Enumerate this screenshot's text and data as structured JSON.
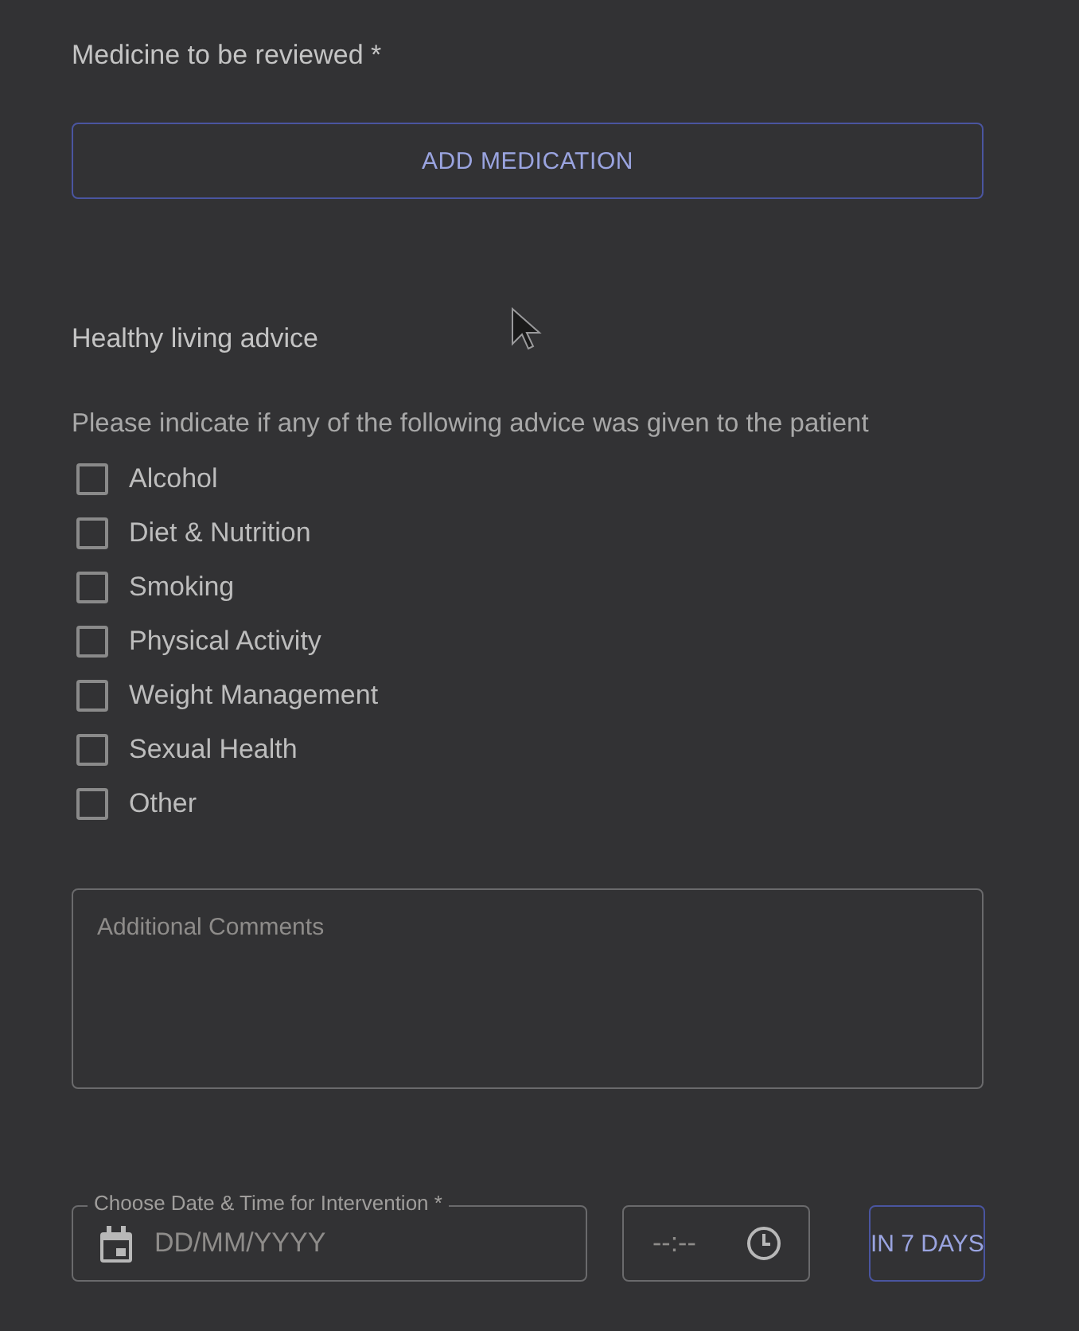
{
  "medicine": {
    "label": "Medicine to be reviewed *",
    "add_button": "ADD MEDICATION"
  },
  "healthy_living": {
    "heading": "Healthy living advice",
    "instruction": "Please indicate if any of the following advice was given to the patient",
    "options": [
      {
        "label": "Alcohol",
        "checked": false
      },
      {
        "label": "Diet & Nutrition",
        "checked": false
      },
      {
        "label": "Smoking",
        "checked": false
      },
      {
        "label": "Physical Activity",
        "checked": false
      },
      {
        "label": "Weight Management",
        "checked": false
      },
      {
        "label": "Sexual Health",
        "checked": false
      },
      {
        "label": "Other",
        "checked": false
      }
    ]
  },
  "comments": {
    "placeholder": "Additional Comments"
  },
  "intervention": {
    "date_label": "Choose Date & Time for Intervention *",
    "date_placeholder": "DD/MM/YYYY",
    "time_placeholder": "--:--",
    "quick_button": "IN 7 DAYS"
  }
}
